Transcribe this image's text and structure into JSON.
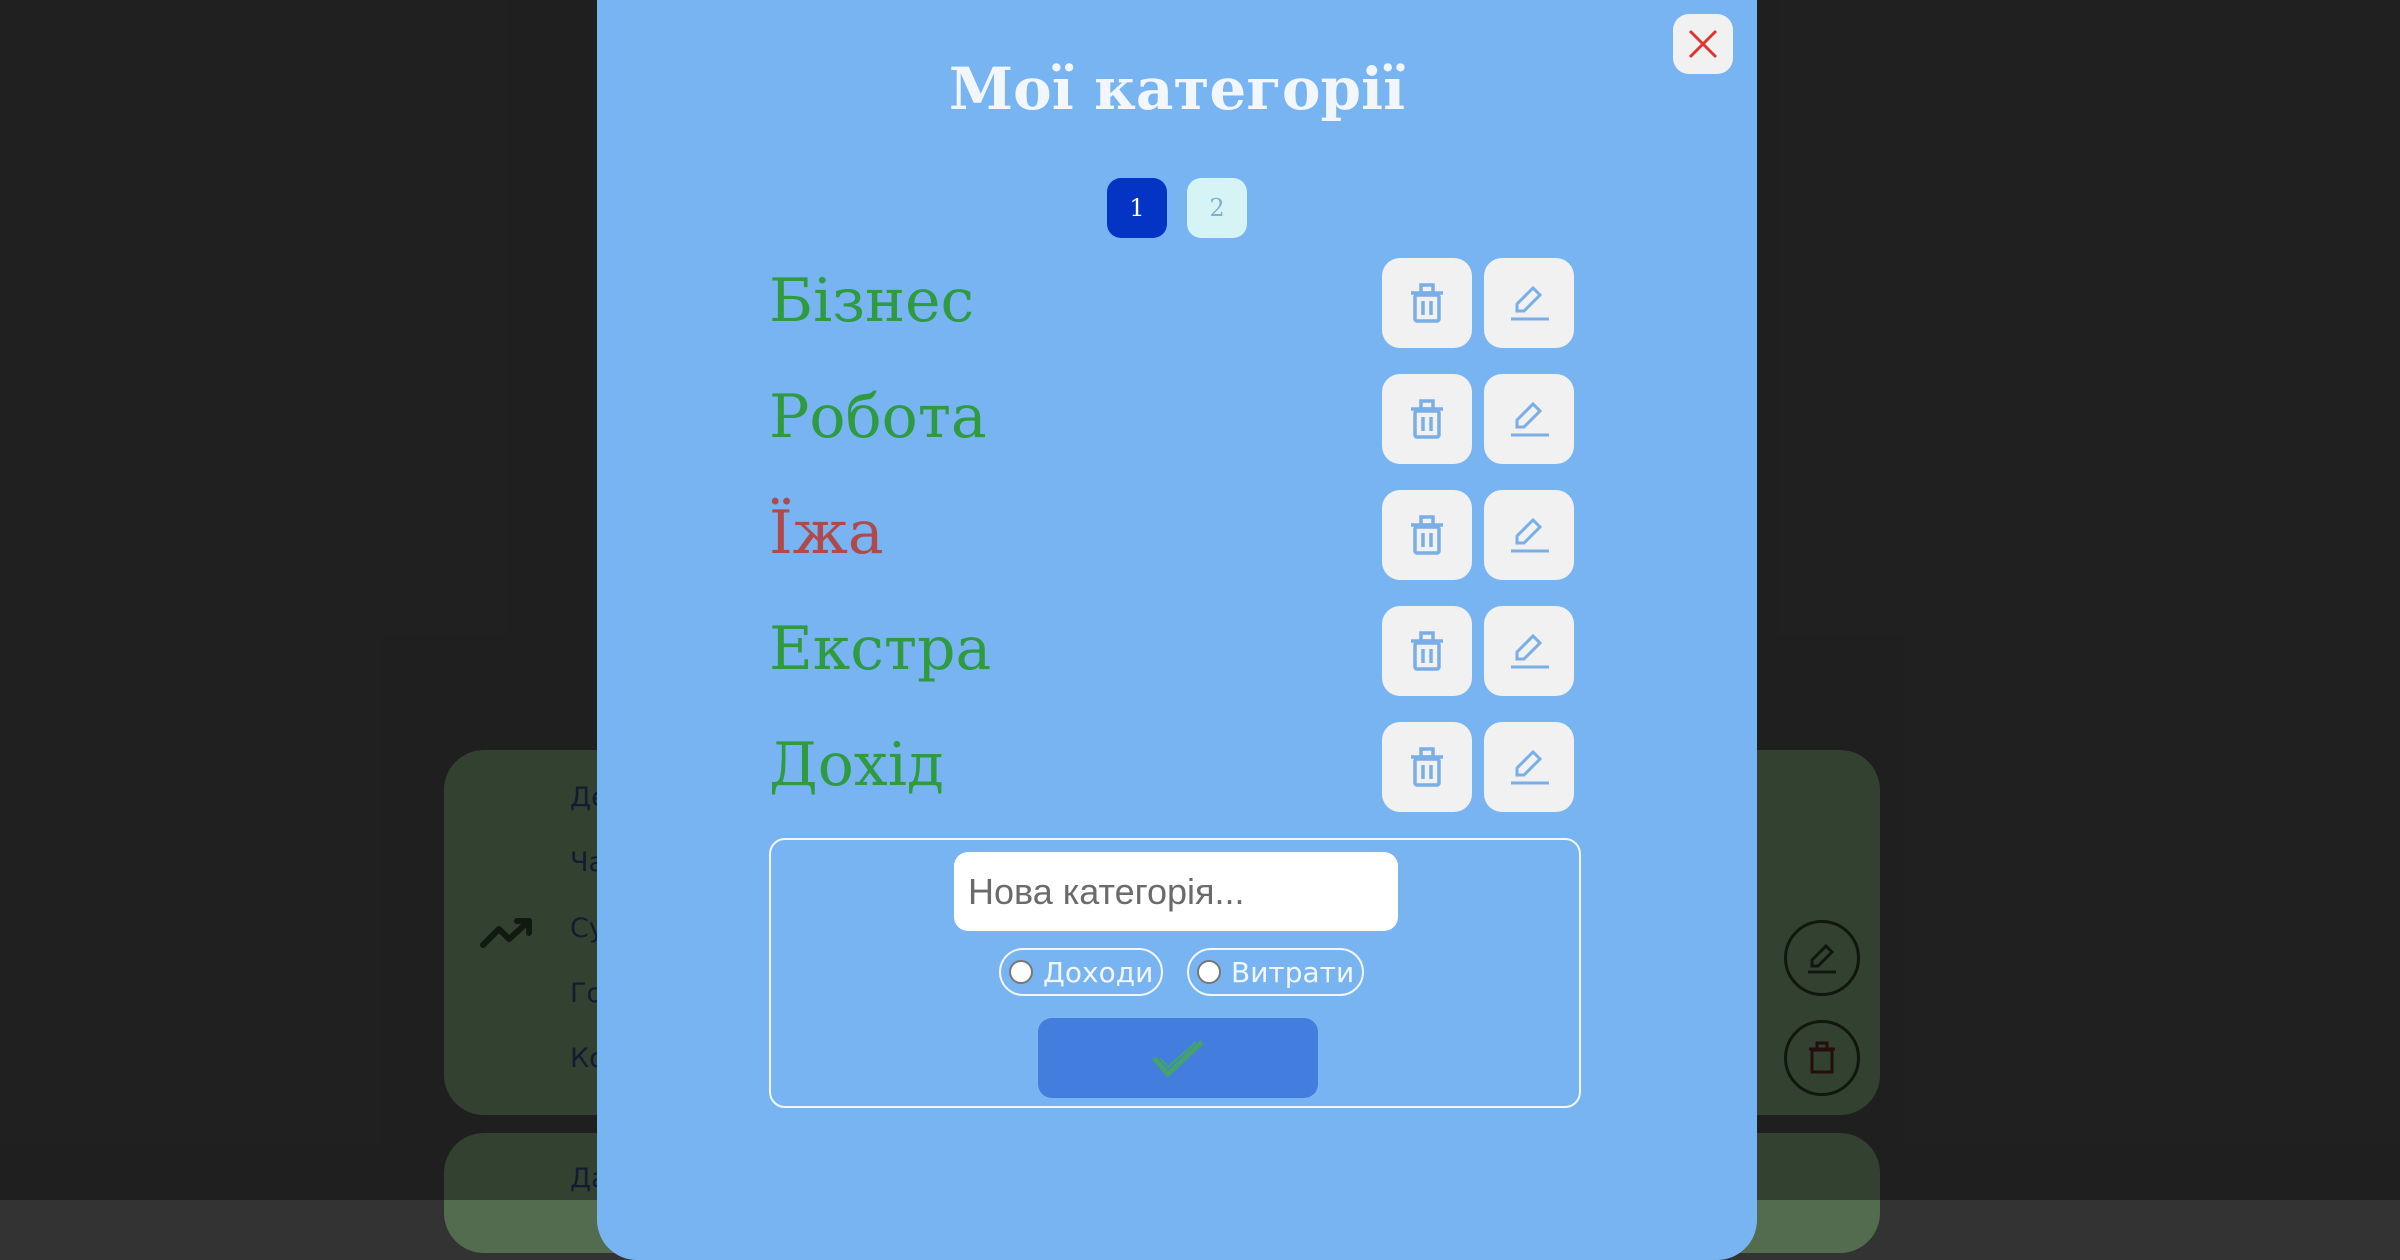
{
  "background": {
    "card_lines": [
      "Де",
      "Ча",
      "Су",
      "Го",
      "Ко"
    ],
    "card2_lines": [
      "Да"
    ],
    "icons": [
      "trend-up-icon",
      "pencil-icon",
      "trash-icon"
    ]
  },
  "modal": {
    "title": "Мої категорії",
    "close_icon": "close-icon",
    "pages": [
      "1",
      "2"
    ],
    "active_page": "1",
    "categories": [
      {
        "name": "Бізнес",
        "type": "income"
      },
      {
        "name": "Робота",
        "type": "income"
      },
      {
        "name": "Їжа",
        "type": "expense"
      },
      {
        "name": "Екстра",
        "type": "income"
      },
      {
        "name": "Дохід",
        "type": "income"
      }
    ],
    "form": {
      "input_placeholder": "Нова категорія...",
      "input_value": "",
      "radio_income": "Доходи",
      "radio_expense": "Витрати",
      "submit_icon": "check-icon"
    }
  },
  "colors": {
    "modal_bg": "#77b4f1",
    "income": "#2f9a3f",
    "expense": "#b04a4a",
    "active_page": "#0434c4",
    "submit": "#437ddd",
    "close_x": "#e03434"
  }
}
